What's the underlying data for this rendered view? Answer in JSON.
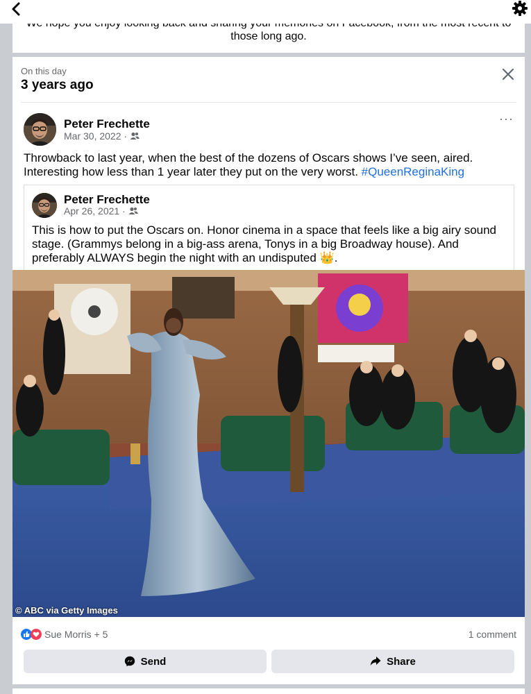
{
  "intro": {
    "line1": "We hope you enjoy looking back and sharing your memories on Facebook, from the most recent to",
    "line2": "those long ago."
  },
  "memory": {
    "label": "On this day",
    "years_ago": "3 years ago"
  },
  "post": {
    "author": "Peter Frechette",
    "date": "Mar 30, 2022 ·",
    "text": "Throwback to last year, when the best of the dozens of Oscars shows I’ve seen, aired. Interesting how less than 1 year later they put on the very worst. ",
    "hashtag": "#QueenReginaKing",
    "menu": "···"
  },
  "shared_post": {
    "author": "Peter Frechette",
    "date": "Apr 26, 2021 ·",
    "text": "This is how to put the Oscars on. Honor cinema in a space that feels like a big airy sound stage. (Grammys belong in a big-ass arena, Tonys in a big Broadway house). And preferably ALWAYS begin the night with an undisputed ",
    "emoji": "👑",
    "text_end": "."
  },
  "photo": {
    "credit": "© ABC via Getty Images"
  },
  "reactions": {
    "names": "Sue Morris + 5",
    "comments": "1 comment"
  },
  "actions": {
    "send": "Send",
    "share": "Share"
  },
  "icons": {
    "back": "chevron-left-icon",
    "settings": "gear-icon",
    "close": "close-icon",
    "audience": "friends-icon",
    "like": "like-reaction-icon",
    "love": "love-reaction-icon",
    "messenger": "messenger-icon",
    "share": "share-arrow-icon"
  },
  "colors": {
    "link": "#216fdb",
    "like": "#1877f2",
    "love": "#f33e58",
    "button_bg": "#e4e6eb"
  }
}
